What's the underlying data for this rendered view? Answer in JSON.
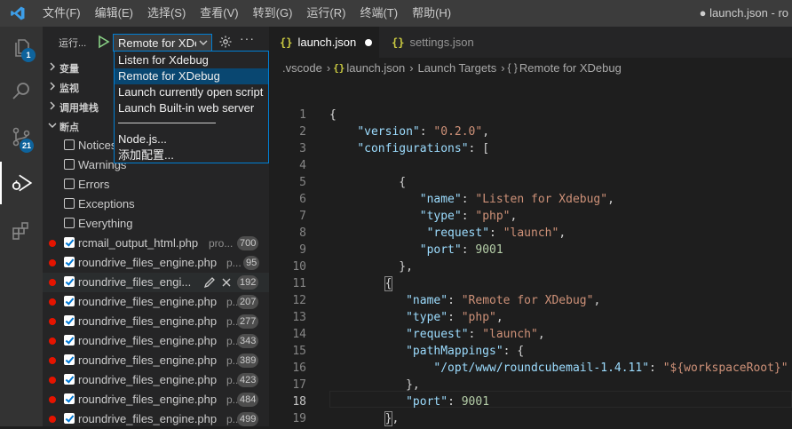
{
  "titlebar": {
    "menus": [
      "文件(F)",
      "编辑(E)",
      "选择(S)",
      "查看(V)",
      "转到(G)",
      "运行(R)",
      "终端(T)",
      "帮助(H)"
    ],
    "window_title": "● launch.json - ro"
  },
  "activitybar": {
    "explorer_badge": "1",
    "scm_badge": "21"
  },
  "debug_toolbar": {
    "run_label": "运行...",
    "selected_config": "Remote for XDebug",
    "more": "···"
  },
  "dropdown": {
    "items": [
      "Listen for Xdebug",
      "Remote for XDebug",
      "Launch currently open script",
      "Launch Built-in web server",
      "Node.js...",
      "添加配置..."
    ]
  },
  "sections": {
    "variables": "变量",
    "watch": "监视",
    "callstack": "调用堆栈",
    "breakpoints": "断点"
  },
  "exception_breakpoints": [
    "Notices",
    "Warnings",
    "Errors",
    "Exceptions",
    "Everything"
  ],
  "breakpoints": [
    {
      "file": "rcmail_output_html.php",
      "path": "pro...",
      "line": "700"
    },
    {
      "file": "roundrive_files_engine.php",
      "path": "p...",
      "line": "95"
    },
    {
      "file": "roundrive_files_engi...",
      "path": "",
      "line": "192"
    },
    {
      "file": "roundrive_files_engine.php",
      "path": "p...",
      "line": "207"
    },
    {
      "file": "roundrive_files_engine.php",
      "path": "p...",
      "line": "277"
    },
    {
      "file": "roundrive_files_engine.php",
      "path": "p...",
      "line": "343"
    },
    {
      "file": "roundrive_files_engine.php",
      "path": "p...",
      "line": "389"
    },
    {
      "file": "roundrive_files_engine.php",
      "path": "p...",
      "line": "423"
    },
    {
      "file": "roundrive_files_engine.php",
      "path": "p...",
      "line": "484"
    },
    {
      "file": "roundrive_files_engine.php",
      "path": "p...",
      "line": "499"
    }
  ],
  "tabs": [
    {
      "label": "launch.json",
      "icon": "{}"
    },
    {
      "label": "settings.json",
      "icon": "{}"
    }
  ],
  "breadcrumb": [
    ".vscode",
    "launch.json",
    "Launch Targets",
    "Remote for XDebug"
  ],
  "editor": {
    "line_numbers": [
      "1",
      "2",
      "3",
      "4",
      "5",
      "6",
      "7",
      "8",
      "9",
      "10",
      "11",
      "12",
      "13",
      "14",
      "15",
      "16",
      "17",
      "18",
      "19"
    ],
    "current_line": "18"
  }
}
